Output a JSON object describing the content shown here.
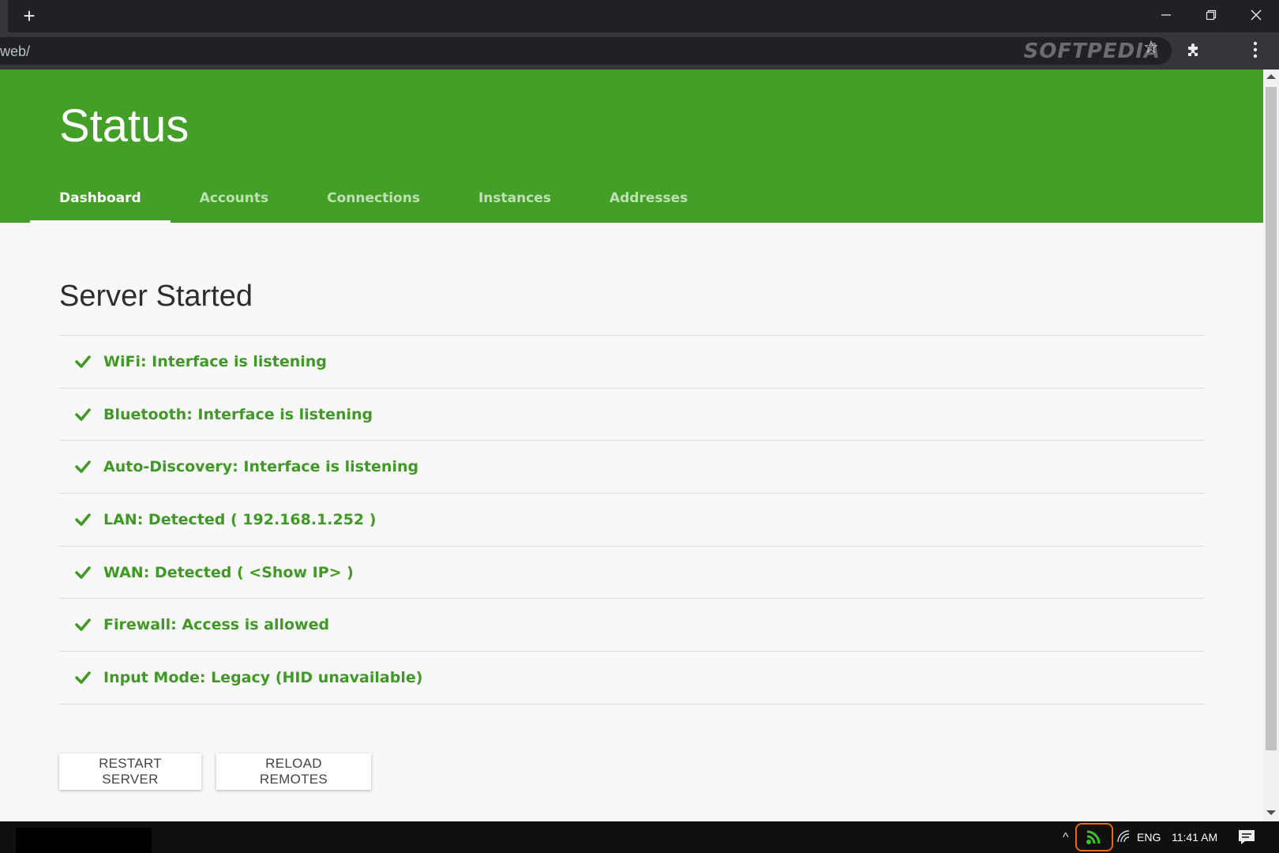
{
  "browser": {
    "new_tab_label": "+",
    "url": "web/",
    "watermark": "SOFTPEDIA"
  },
  "page": {
    "title": "Status",
    "tabs": [
      {
        "label": "Dashboard",
        "active": true
      },
      {
        "label": "Accounts",
        "active": false
      },
      {
        "label": "Connections",
        "active": false
      },
      {
        "label": "Instances",
        "active": false
      },
      {
        "label": "Addresses",
        "active": false
      }
    ],
    "section_title": "Server Started",
    "status_items": [
      "WiFi: Interface is listening",
      "Bluetooth: Interface is listening",
      "Auto-Discovery: Interface is listening",
      "LAN: Detected ( 192.168.1.252 )",
      "WAN: Detected ( <Show IP> )",
      "Firewall: Access is allowed",
      "Input Mode: Legacy (HID unavailable)"
    ],
    "buttons": {
      "restart": "RESTART SERVER",
      "reload": "RELOAD REMOTES"
    }
  },
  "taskbar": {
    "tray_arrow": "^",
    "language": "ENG",
    "time": "11:41 AM"
  },
  "colors": {
    "header_green": "#439f27",
    "status_green": "#3f9a25",
    "highlight_orange": "#e56b12"
  },
  "icons": {
    "status": "check-icon",
    "tray_app": "cast-icon"
  }
}
